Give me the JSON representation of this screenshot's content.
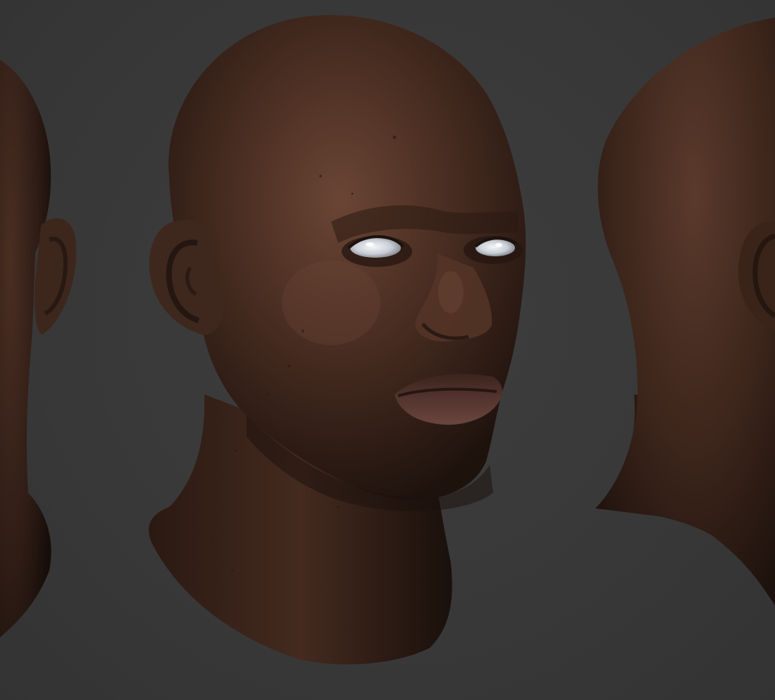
{
  "scene": {
    "background_color": "#3a3a3a",
    "skin_base_color": "#4a2e22",
    "skin_highlight_color": "#6a4535",
    "skin_shadow_color": "#1e120d",
    "lip_color": "#5e3a35",
    "eye_color": "#dfe3e8",
    "views": [
      {
        "name": "head-view-front-left",
        "orientation": "three-quarter-left",
        "cropped": "left-edge"
      },
      {
        "name": "head-view-three-quarter",
        "orientation": "three-quarter-right",
        "cropped": "none"
      },
      {
        "name": "head-view-back-right",
        "orientation": "back-three-quarter",
        "cropped": "right-edge"
      }
    ]
  }
}
